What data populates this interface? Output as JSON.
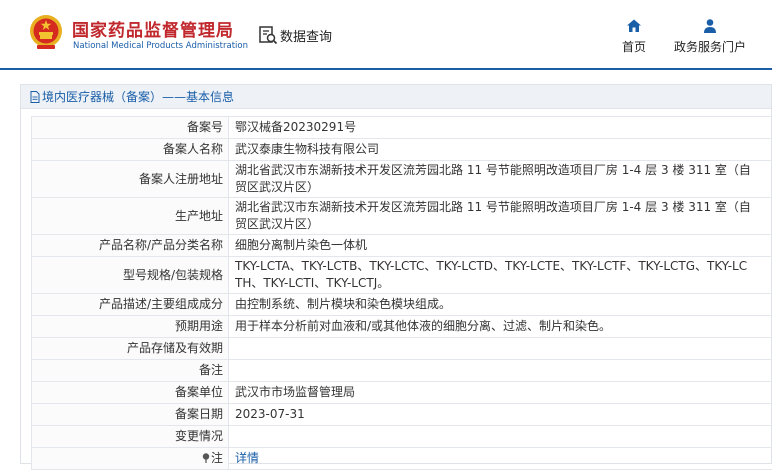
{
  "header": {
    "org_cn": "国家药品监督管理局",
    "org_en": "National Medical Products Administration",
    "query_label": "数据查询",
    "nav": [
      {
        "label": "首页",
        "icon": "home-icon"
      },
      {
        "label": "政务服务门户",
        "icon": "user-icon"
      }
    ]
  },
  "panel": {
    "breadcrumb": "境内医疗器械（备案）——基本信息"
  },
  "record": {
    "rows": [
      {
        "label": "备案号",
        "value": "鄂汉械备20230291号"
      },
      {
        "label": "备案人名称",
        "value": "武汉泰康生物科技有限公司"
      },
      {
        "label": "备案人注册地址",
        "value": "湖北省武汉市东湖新技术开发区流芳园北路 11 号节能照明改造项目厂房 1-4 层 3 楼 311 室（自贸区武汉片区）"
      },
      {
        "label": "生产地址",
        "value": "湖北省武汉市东湖新技术开发区流芳园北路 11 号节能照明改造项目厂房 1-4 层 3 楼 311 室（自贸区武汉片区）"
      },
      {
        "label": "产品名称/产品分类名称",
        "value": "细胞分离制片染色一体机"
      },
      {
        "label": "型号规格/包装规格",
        "value": "TKY-LCTA、TKY-LCTB、TKY-LCTC、TKY-LCTD、TKY-LCTE、TKY-LCTF、TKY-LCTG、TKY-LCTH、TKY-LCTI、TKY-LCTJ。"
      },
      {
        "label": "产品描述/主要组成成分",
        "value": "由控制系统、制片模块和染色模块组成。"
      },
      {
        "label": "预期用途",
        "value": "用于样本分析前对血液和/或其他体液的细胞分离、过滤、制片和染色。"
      },
      {
        "label": "产品存储及有效期",
        "value": ""
      },
      {
        "label": "备注",
        "value": ""
      },
      {
        "label": "备案单位",
        "value": "武汉市市场监督管理局"
      },
      {
        "label": "备案日期",
        "value": "2023-07-31"
      },
      {
        "label": "变更情况",
        "value": ""
      },
      {
        "label": "注",
        "value": "详情"
      }
    ]
  },
  "colors": {
    "brand_red": "#c0282d",
    "brand_blue": "#1a5ea8"
  }
}
